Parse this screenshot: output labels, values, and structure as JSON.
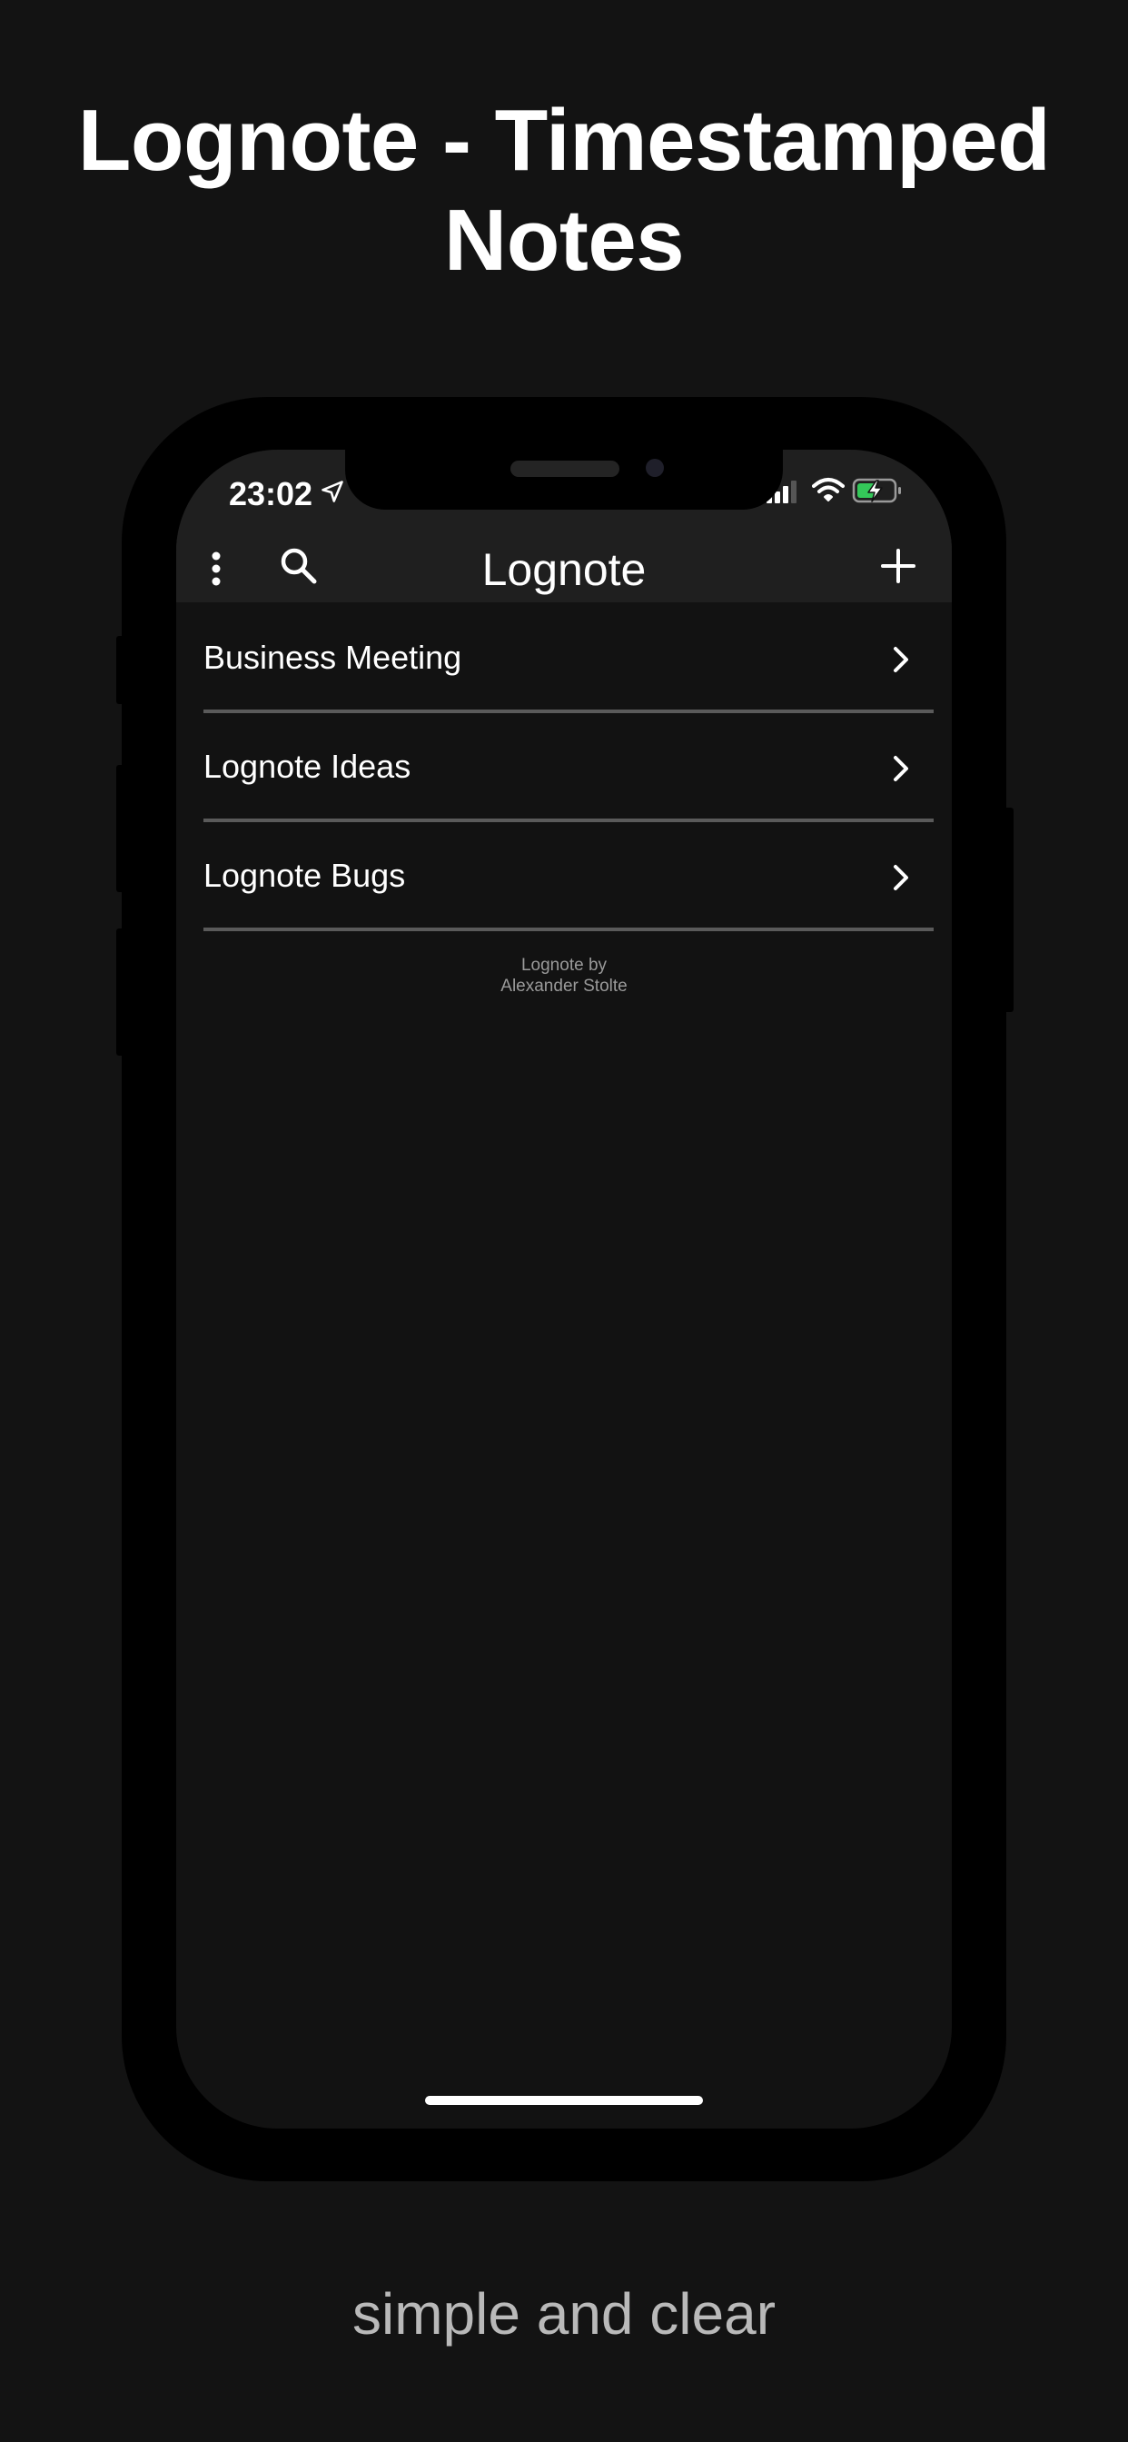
{
  "promo": {
    "headline_line1": "Lognote - Timestamped",
    "headline_line2": "Notes",
    "tagline": "simple and clear"
  },
  "status_bar": {
    "time": "23:02",
    "icons": [
      "location-arrow-icon",
      "cellular-signal-icon",
      "wifi-icon",
      "battery-charging-icon"
    ]
  },
  "nav": {
    "title": "Lognote",
    "left_icons": [
      "more-vertical-icon",
      "search-icon"
    ],
    "right_icon": "plus-icon"
  },
  "notebooks": [
    {
      "label": "Business Meeting"
    },
    {
      "label": "Lognote Ideas"
    },
    {
      "label": "Lognote Bugs"
    }
  ],
  "footer": {
    "credit_line1": "Lognote by",
    "credit_line2": "Alexander Stolte"
  },
  "colors": {
    "background": "#131313",
    "screen": "#121212",
    "bar": "#1f1f1f",
    "divider": "#5a5a5a",
    "battery_green": "#34c759"
  }
}
